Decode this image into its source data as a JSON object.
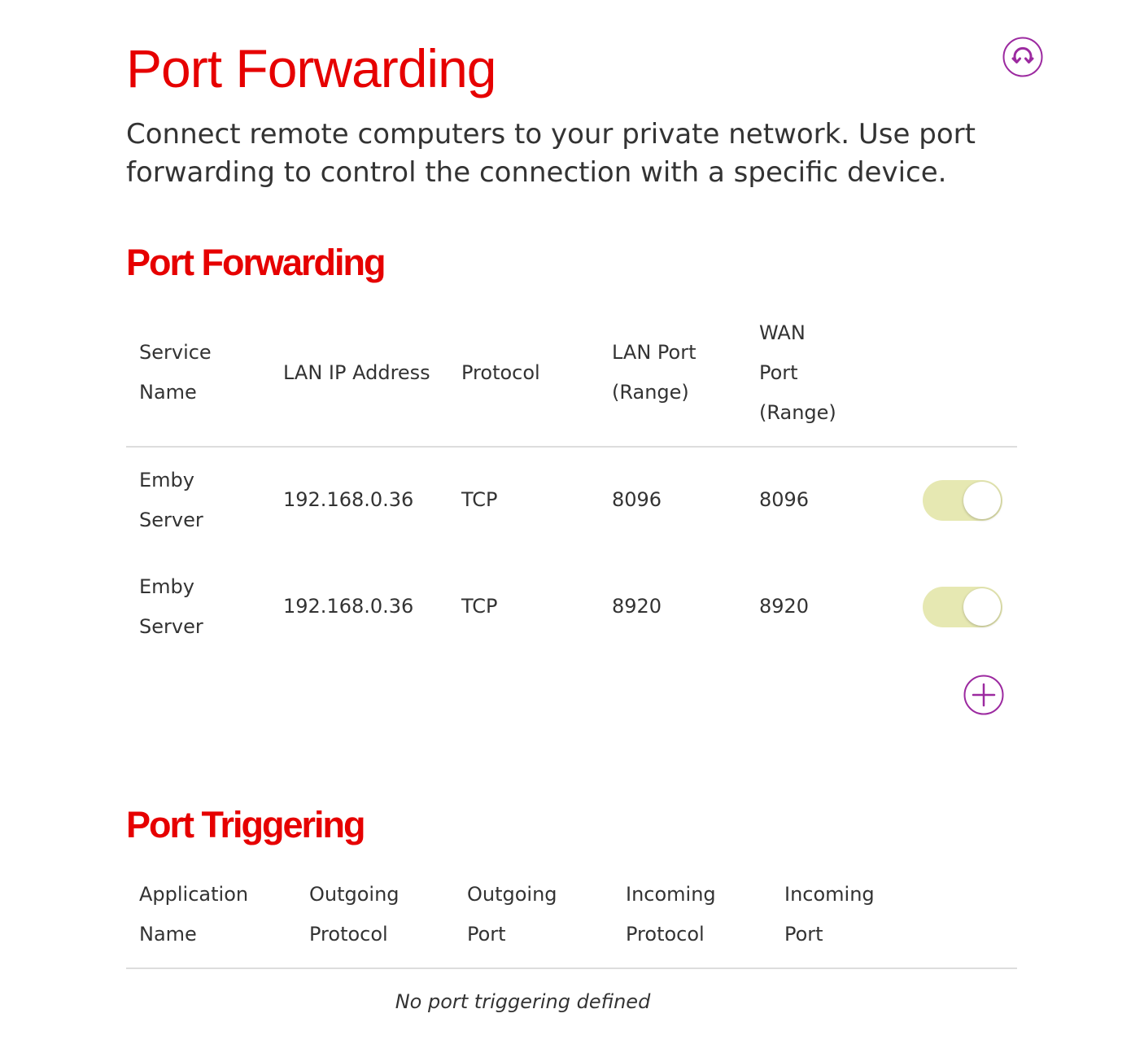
{
  "page": {
    "title": "Port Forwarding",
    "description": "Connect remote computers to your private network. Use port forwarding to control the connection with a specific device."
  },
  "port_forwarding": {
    "section_title": "Port Forwarding",
    "headers": [
      "Service\nName",
      "LAN IP Address",
      "Protocol",
      "LAN Port\n(Range)",
      "WAN\nPort\n(Range)"
    ],
    "rows": [
      {
        "service_name": "Emby\nServer",
        "lan_ip": "192.168.0.36",
        "protocol": "TCP",
        "lan_port": "8096",
        "wan_port": "8096",
        "enabled": true
      },
      {
        "service_name": "Emby\nServer",
        "lan_ip": "192.168.0.36",
        "protocol": "TCP",
        "lan_port": "8920",
        "wan_port": "8920",
        "enabled": true
      }
    ]
  },
  "port_triggering": {
    "section_title": "Port Triggering",
    "headers": [
      "Application\nName",
      "Outgoing\nProtocol",
      "Outgoing\nPort",
      "Incoming\nProtocol",
      "Incoming\nPort"
    ],
    "empty_message": "No port triggering defined"
  },
  "colors": {
    "brand_red": "#e60000",
    "icon_purple": "#9c2aa0",
    "toggle_on": "#e6e8b2"
  },
  "icons": {
    "refresh": "refresh-icon",
    "add": "plus-circle-icon"
  }
}
